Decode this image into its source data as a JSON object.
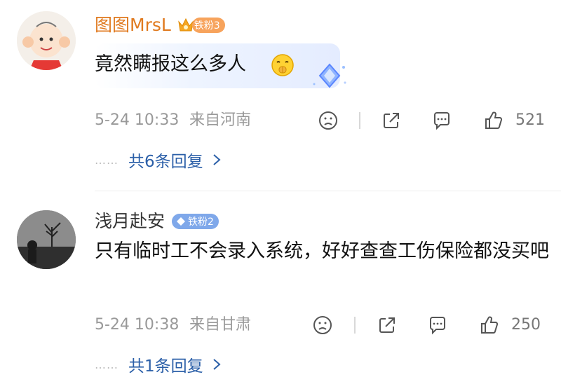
{
  "comments": [
    {
      "user": "图图MrsL",
      "badge": "铁粉3",
      "text": "竟然瞒报这么多人",
      "time": "5-24 10:33",
      "location": "来自河南",
      "likes": "521",
      "replies": "共6条回复"
    },
    {
      "user": "浅月赴安",
      "badge": "铁粉2",
      "text": "只有临时工不会录入系统，好好查查工伤保险都没买吧",
      "time": "5-24 10:38",
      "location": "来自甘肃",
      "likes": "250",
      "replies": "共1条回复"
    }
  ],
  "icons": {
    "reply_dots": "……",
    "emoji": "shushing-face-icon"
  },
  "colors": {
    "name_highlight": "#e07a1f",
    "link": "#2b5fa8",
    "badge_orange": "#f7a35c",
    "badge_blue": "#7fa8ea",
    "meta_gray": "#999999"
  }
}
